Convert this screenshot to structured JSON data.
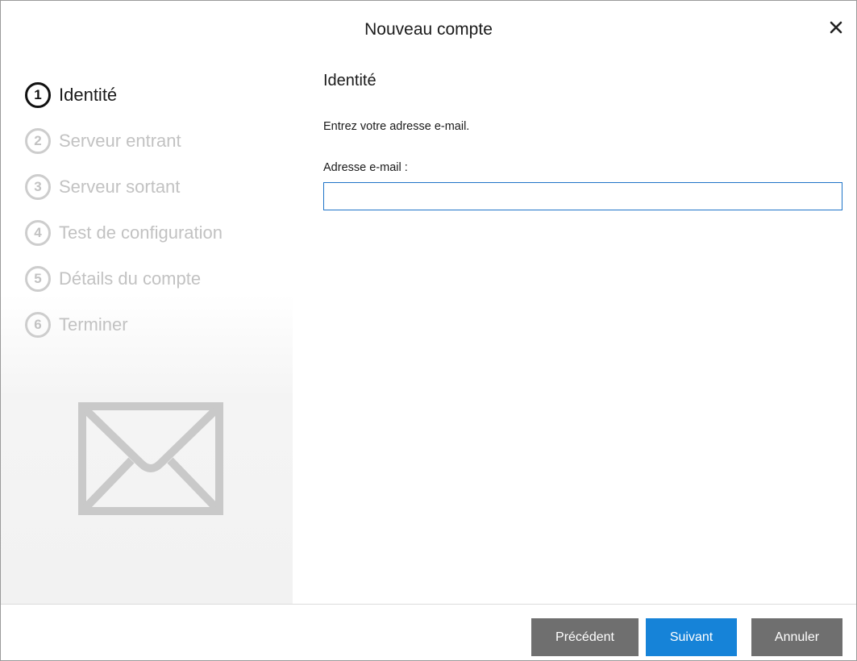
{
  "window": {
    "title": "Nouveau compte"
  },
  "steps": [
    {
      "number": "1",
      "label": "Identité",
      "active": true
    },
    {
      "number": "2",
      "label": "Serveur entrant",
      "active": false
    },
    {
      "number": "3",
      "label": "Serveur sortant",
      "active": false
    },
    {
      "number": "4",
      "label": "Test de configuration",
      "active": false
    },
    {
      "number": "5",
      "label": "Détails du compte",
      "active": false
    },
    {
      "number": "6",
      "label": "Terminer",
      "active": false
    }
  ],
  "main": {
    "section_title": "Identité",
    "instruction": "Entrez votre adresse e-mail.",
    "email_label": "Adresse e-mail :",
    "email_value": ""
  },
  "footer": {
    "prev_label": "Précédent",
    "next_label": "Suivant",
    "cancel_label": "Annuler"
  },
  "icons": {
    "close": "close-icon",
    "envelope": "envelope-icon"
  },
  "colors": {
    "accent": "#1683d8",
    "button_gray": "#6f6f6f",
    "inactive_text": "#c2c2c2",
    "input_border": "#1f74c8"
  }
}
